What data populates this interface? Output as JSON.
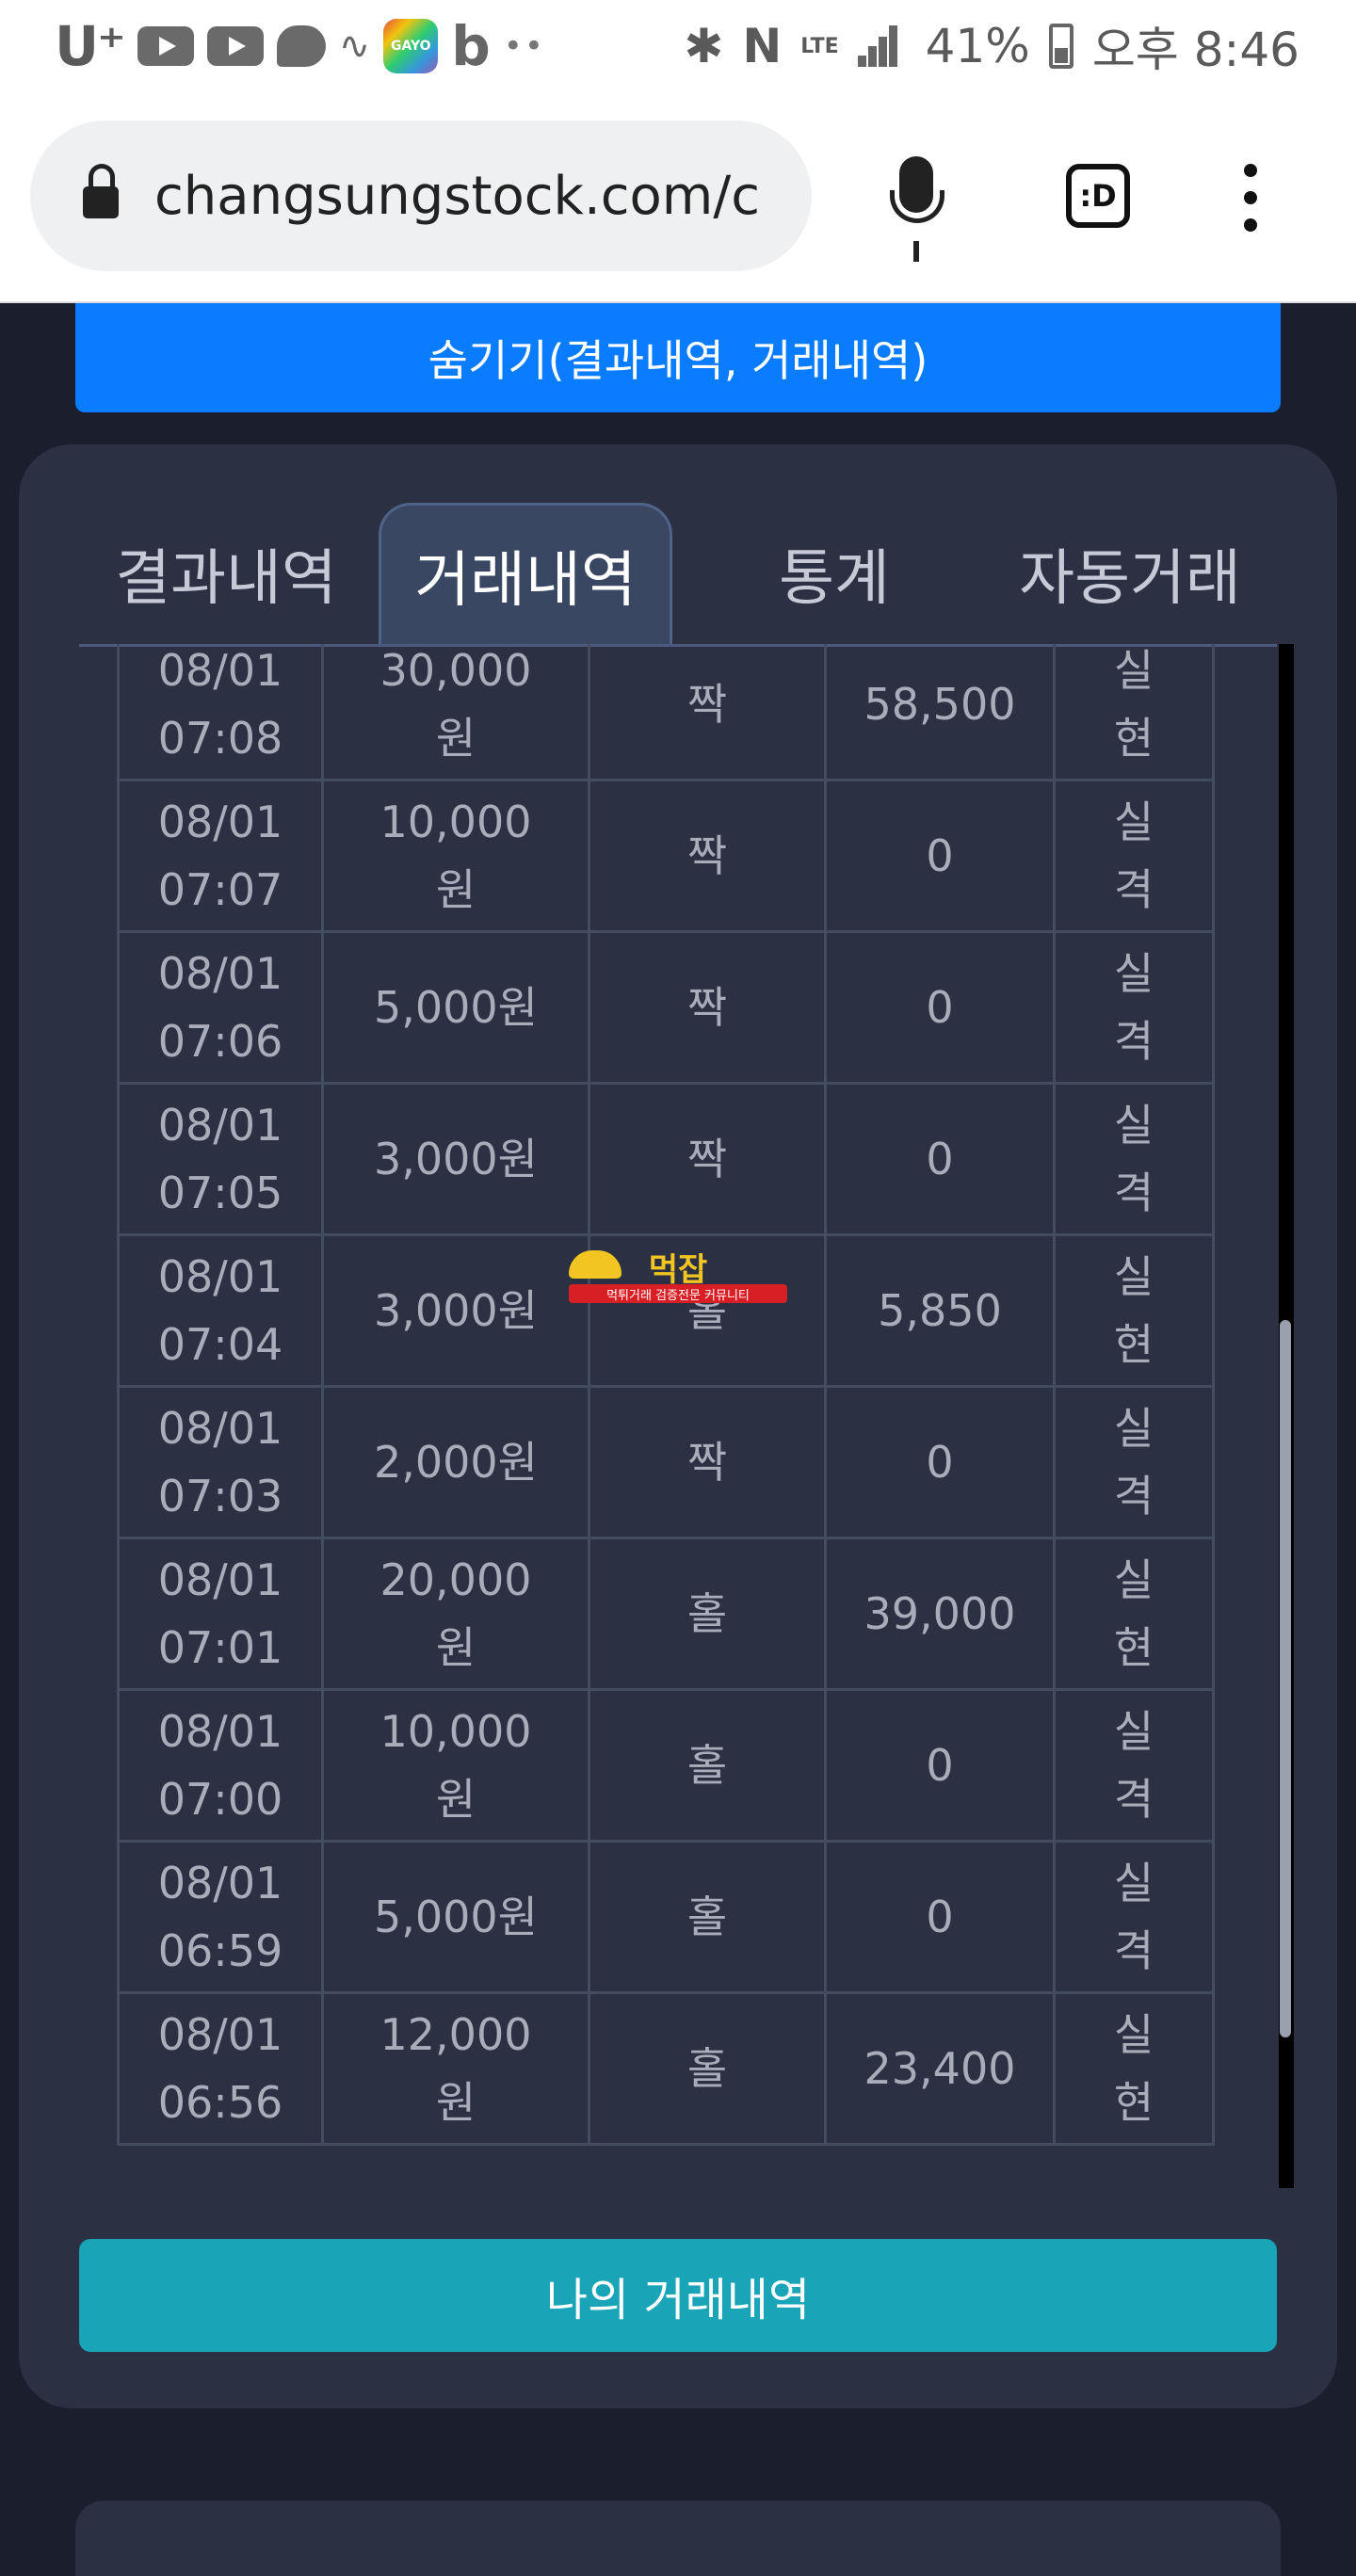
{
  "status_bar": {
    "carrier": "U⁺",
    "gayo_label": "GAYO",
    "battery": "41%",
    "time": "오후 8:46",
    "network": "LTE"
  },
  "browser": {
    "url": "changsungstock.com/c",
    "tabs_icon_label": ":D"
  },
  "hide_button": "숨기기(결과내역, 거래내역)",
  "tabs": [
    {
      "label": "결과내역"
    },
    {
      "label": "거래내역"
    },
    {
      "label": "통계"
    },
    {
      "label": "자동거래"
    }
  ],
  "active_tab": "거래내역",
  "trades": [
    {
      "date": "08/01",
      "time": "07:08",
      "amount": "30,000",
      "unit": "원",
      "pick": "짝",
      "payout": "58,500",
      "result_a": "실",
      "result_b": "현",
      "status": "win"
    },
    {
      "date": "08/01",
      "time": "07:07",
      "amount": "10,000",
      "unit": "원",
      "pick": "짝",
      "payout": "0",
      "result_a": "실",
      "result_b": "격",
      "status": "lose"
    },
    {
      "date": "08/01",
      "time": "07:06",
      "amount": "5,000원",
      "unit": "",
      "pick": "짝",
      "payout": "0",
      "result_a": "실",
      "result_b": "격",
      "status": "lose"
    },
    {
      "date": "08/01",
      "time": "07:05",
      "amount": "3,000원",
      "unit": "",
      "pick": "짝",
      "payout": "0",
      "result_a": "실",
      "result_b": "격",
      "status": "lose"
    },
    {
      "date": "08/01",
      "time": "07:04",
      "amount": "3,000원",
      "unit": "",
      "pick": "홀",
      "payout": "5,850",
      "result_a": "실",
      "result_b": "현",
      "status": "win"
    },
    {
      "date": "08/01",
      "time": "07:03",
      "amount": "2,000원",
      "unit": "",
      "pick": "짝",
      "payout": "0",
      "result_a": "실",
      "result_b": "격",
      "status": "lose"
    },
    {
      "date": "08/01",
      "time": "07:01",
      "amount": "20,000",
      "unit": "원",
      "pick": "홀",
      "payout": "39,000",
      "result_a": "실",
      "result_b": "현",
      "status": "win"
    },
    {
      "date": "08/01",
      "time": "07:00",
      "amount": "10,000",
      "unit": "원",
      "pick": "홀",
      "payout": "0",
      "result_a": "실",
      "result_b": "격",
      "status": "lose"
    },
    {
      "date": "08/01",
      "time": "06:59",
      "amount": "5,000원",
      "unit": "",
      "pick": "홀",
      "payout": "0",
      "result_a": "실",
      "result_b": "격",
      "status": "lose"
    },
    {
      "date": "08/01",
      "time": "06:56",
      "amount": "12,000",
      "unit": "원",
      "pick": "홀",
      "payout": "23,400",
      "result_a": "실",
      "result_b": "현",
      "status": "win"
    }
  ],
  "watermark": {
    "title": "먹잡",
    "subtitle": "먹튀거래 검증전문 커뮤니티"
  },
  "my_trades_button": "나의 거래내역",
  "colors": {
    "win": "#3ec45a",
    "lose": "#e0454a",
    "hide_button": "#0a7cff",
    "my_trades_button": "#19a4b8"
  }
}
